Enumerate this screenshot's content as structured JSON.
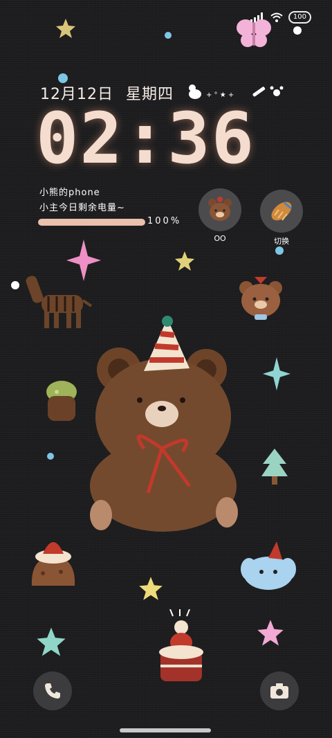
{
  "status_bar": {
    "battery": "100"
  },
  "lockscreen": {
    "date": "12月12日",
    "weekday": "星期四",
    "time": "02:36",
    "device_name": "小熊的phone",
    "battery_caption": "小主今日剩余电量~",
    "battery_percent_label": "100%",
    "battery_level": 1.0
  },
  "widgets": [
    {
      "label": "OO",
      "icon": "bear-face-icon"
    },
    {
      "label": "切换",
      "icon": "bread-icon"
    }
  ],
  "shortcuts": {
    "left_icon": "phone-icon",
    "right_icon": "camera-icon"
  },
  "colors": {
    "background": "#1f1f21",
    "clock": "#f4dccf",
    "battery_bar": "#e9c1ad",
    "accent_pink": "#f3b3d8"
  }
}
